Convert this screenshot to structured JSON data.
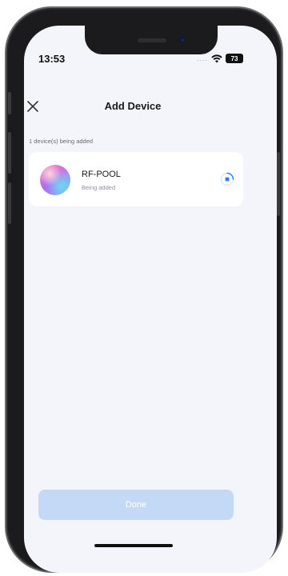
{
  "status_bar": {
    "time": "13:53",
    "signal": "....",
    "battery": "73"
  },
  "header": {
    "title": "Add Device"
  },
  "section": {
    "label": "1 device(s) being added"
  },
  "device": {
    "name": "RF-POOL",
    "status": "Being added"
  },
  "footer": {
    "done_label": "Done"
  },
  "colors": {
    "screen_background": "#f3f5fa",
    "done_button_disabled": "#c4d9f5",
    "accent_blue": "#2f7cf6"
  },
  "icons": {
    "close": "close-icon",
    "wifi": "wifi-icon",
    "progress": "loading-spinner-icon"
  }
}
